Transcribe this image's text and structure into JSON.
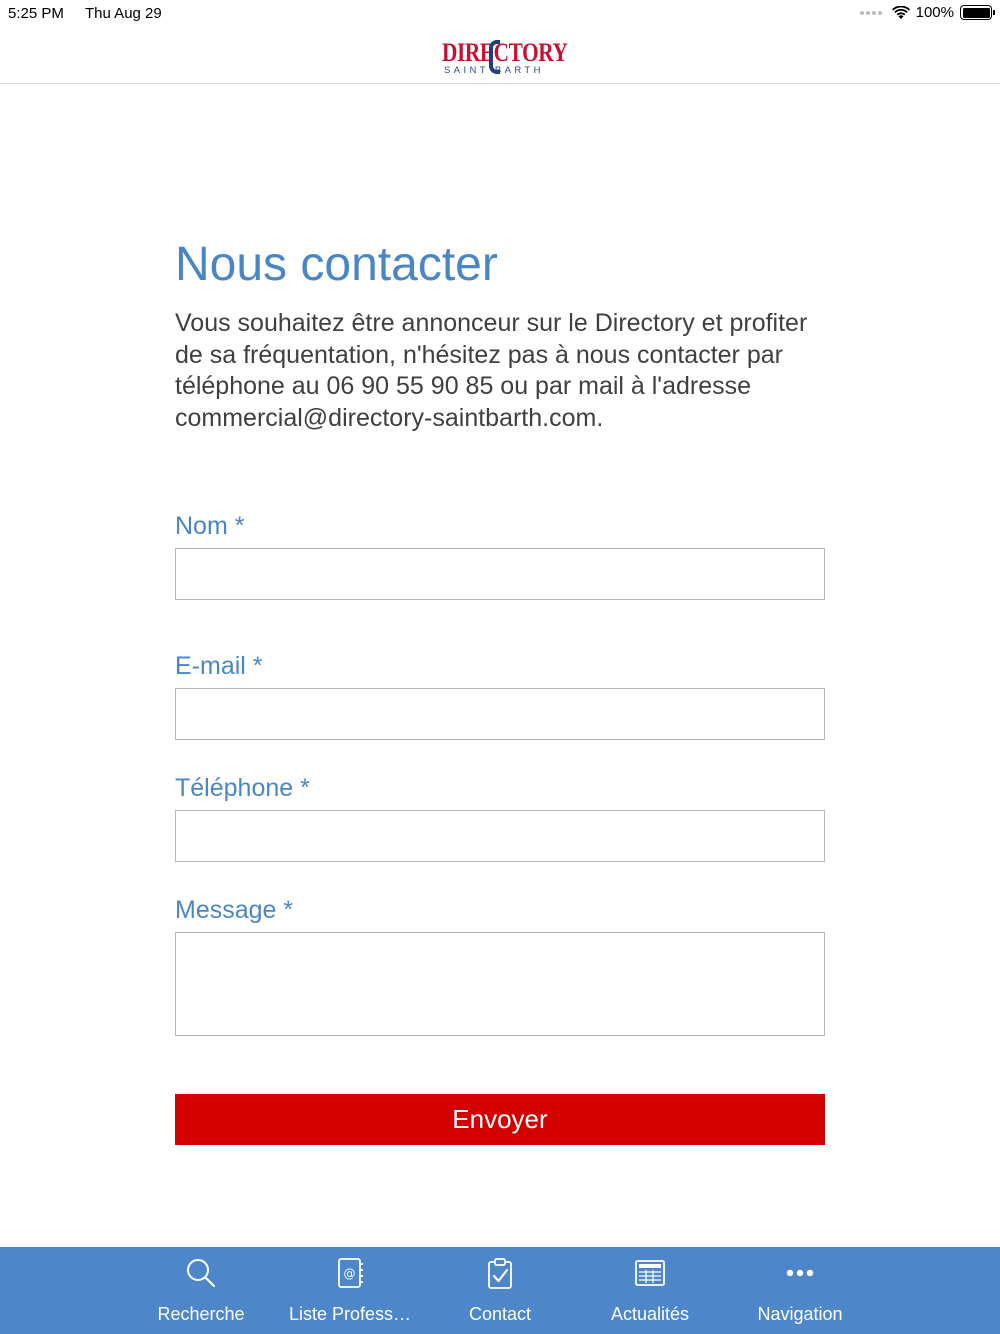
{
  "status_bar": {
    "time": "5:25 PM",
    "date": "Thu Aug 29",
    "battery_text": "100%",
    "battery_level": 1.0
  },
  "header": {
    "logo_text": "DIRECTORY",
    "logo_subtext": "SAINT BARTH",
    "logo_colors": {
      "primary": "#c8102e",
      "secondary": "#1f3d7a"
    }
  },
  "main": {
    "title": "Nous contacter",
    "intro": "Vous souhaitez être annonceur sur le Directory et profiter de sa fréquentation, n'hésitez pas à nous contacter par téléphone au 06 90 55 90 85 ou par mail à l'adresse commercial@directory-saintbarth.com."
  },
  "form": {
    "name_label": "Nom *",
    "name_value": "",
    "email_label": "E-mail *",
    "email_value": "",
    "phone_label": "Téléphone *",
    "phone_value": "",
    "message_label": "Message *",
    "message_value": "",
    "submit_label": "Envoyer"
  },
  "tab_bar": {
    "items": [
      {
        "label": "Recherche",
        "icon": "search-icon"
      },
      {
        "label": "Liste Profess…",
        "icon": "address-book-icon"
      },
      {
        "label": "Contact",
        "icon": "clipboard-check-icon"
      },
      {
        "label": "Actualités",
        "icon": "newspaper-icon"
      },
      {
        "label": "Navigation",
        "icon": "more-dots-icon"
      }
    ]
  },
  "colors": {
    "accent": "#4a86c6",
    "tab_bar": "#4d87c9",
    "submit": "#d40000",
    "body_text": "#3f3f3f"
  }
}
